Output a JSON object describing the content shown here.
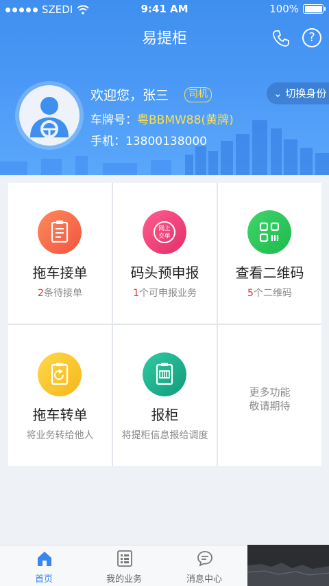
{
  "status_bar": {
    "carrier": "SZEDI",
    "time": "9:41 AM",
    "battery": "100%"
  },
  "nav": {
    "title": "易提柜"
  },
  "user": {
    "welcome": "欢迎您，张三",
    "role": "司机",
    "switch_label": "切换身份",
    "plate_label": "车牌号：",
    "plate_value": "粤BBMW88(黄牌)",
    "phone_label": "手机：",
    "phone_value": "13800138000"
  },
  "features": [
    {
      "title": "拖车接单",
      "count": "2",
      "subtitle": "条待接单",
      "color_from": "#ff8a5c",
      "color_to": "#f2533f",
      "icon": "clipboard-icon"
    },
    {
      "title": "码头预申报",
      "count": "1",
      "subtitle": "个可申报业务",
      "color_from": "#ff5d8f",
      "color_to": "#e22e6b",
      "icon": "online-order-icon",
      "icon_text": "网上交单"
    },
    {
      "title": "查看二维码",
      "count": "5",
      "subtitle": "个二维码",
      "color_from": "#3fd46a",
      "color_to": "#1dbb4d",
      "icon": "qr-code-icon"
    },
    {
      "title": "拖车转单",
      "subtitle": "将业务转给他人",
      "color_from": "#ffd84a",
      "color_to": "#f6b719",
      "icon": "transfer-icon"
    },
    {
      "title": "报柜",
      "subtitle": "将提柜信息报给调度",
      "color_from": "#2fcaa2",
      "color_to": "#129b7b",
      "icon": "container-report-icon"
    }
  ],
  "more": {
    "line1": "更多功能",
    "line2": "敬请期待"
  },
  "tabs": [
    {
      "label": "首页",
      "icon": "home-icon",
      "active": true
    },
    {
      "label": "我的业务",
      "icon": "business-icon",
      "active": false
    },
    {
      "label": "消息中心",
      "icon": "message-icon",
      "active": false
    }
  ],
  "colors": {
    "header": "#4a98f5",
    "accent": "#3a86f0",
    "highlight": "#ffe14d",
    "count_red": "#e32b2b"
  }
}
